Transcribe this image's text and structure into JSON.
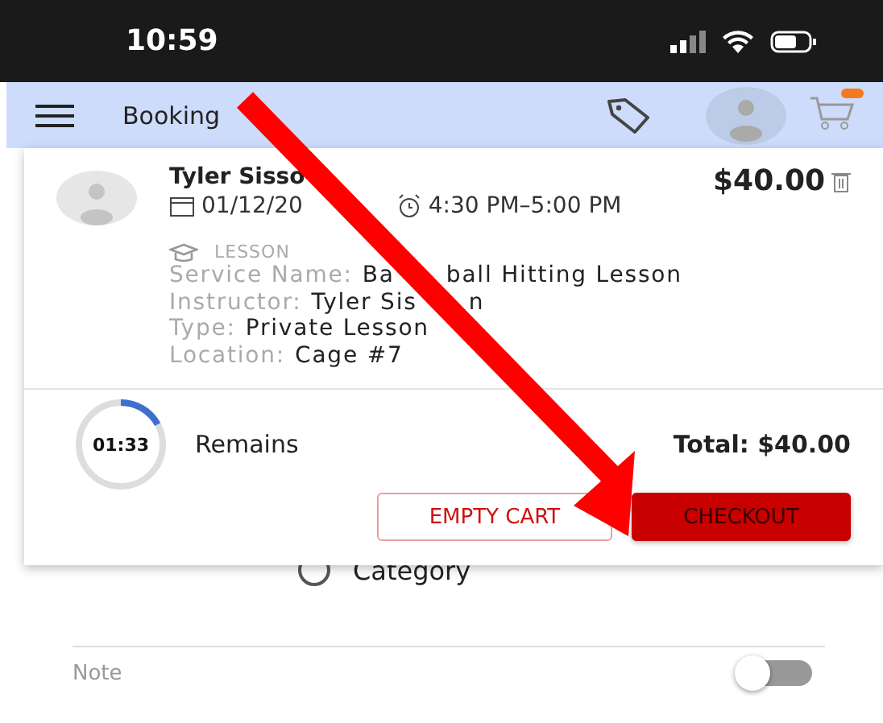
{
  "status_bar": {
    "time": "10:59"
  },
  "app_bar": {
    "title": "Booking"
  },
  "background": {
    "radio": {
      "label": "Category",
      "selected": false
    },
    "note": {
      "label": "Note",
      "on": false
    }
  },
  "cart": {
    "item": {
      "name": "Tyler Sisso",
      "date": "01/12/20",
      "time": "4:30 PM–5:00 PM",
      "price": "$40.00",
      "category": "LESSON",
      "details": [
        {
          "label": "Service Name:",
          "parts": [
            "Ba",
            "ball Hitting Lesson"
          ]
        },
        {
          "label": "Instructor:",
          "parts": [
            "Tyler Sis",
            "n"
          ]
        },
        {
          "label": "Type:",
          "parts": [
            "Private Lesson"
          ]
        },
        {
          "label": "Location:",
          "parts": [
            "Cage #7"
          ]
        }
      ]
    },
    "timer": {
      "reading": "01:33",
      "label": "Remains"
    },
    "total": "Total: $40.00",
    "buttons": [
      {
        "label": "EMPTY CART",
        "kind": "outline"
      },
      {
        "label": "CHECKOUT",
        "kind": "filled"
      }
    ]
  }
}
